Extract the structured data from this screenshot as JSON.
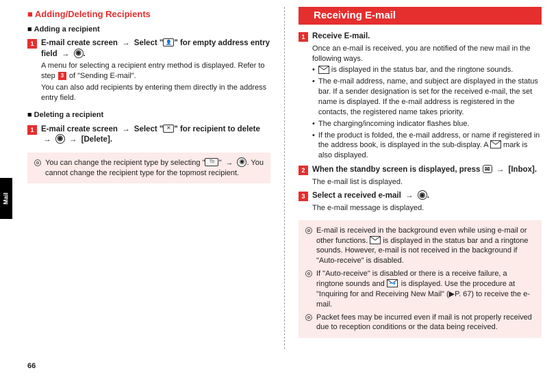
{
  "page_number": "66",
  "side_tab": "Mail",
  "left": {
    "heading": "Adding/Deleting Recipients",
    "add": {
      "sub": "Adding a recipient",
      "step1_a": "E-mail create screen",
      "step1_b": "Select \"",
      "step1_c": "\" for empty address entry field",
      "step1_end": ".",
      "desc1": "A menu for selecting a recipient entry method is displayed. Refer to step",
      "desc1b": "of \"Sending E-mail\".",
      "desc2": "You can also add recipients by entering them directly in the address entry field."
    },
    "del": {
      "sub": "Deleting a recipient",
      "step1_a": "E-mail create screen",
      "step1_b": "Select \"",
      "step1_c": "\" for recipient to delete",
      "step1_d": "[Delete]."
    },
    "note": {
      "a": "You can change the recipient type by selecting \"",
      "b": "\"",
      "c": ". You cannot change the recipient type for the topmost recipient."
    }
  },
  "right": {
    "heading": "Receiving E-mail",
    "s1": {
      "title": "Receive E-mail.",
      "lead": "Once an e-mail is received, you are notified of the new mail in the following ways.",
      "b1a": "",
      "b1b": " is displayed in the status bar, and the ringtone sounds.",
      "b2": "The e-mail address, name, and subject are displayed in the status bar. If a sender designation is set for the received e-mail, the set name is displayed. If the e-mail address is registered in the contacts, the registered name takes priority.",
      "b3": "The charging/incoming indicator flashes blue.",
      "b4a": "If the product is folded, the e-mail address, or name if registered in the address book, is displayed in the sub-display. A ",
      "b4b": " mark is also displayed."
    },
    "s2": {
      "title_a": "When the standby screen is displayed, press ",
      "title_b": "[Inbox].",
      "desc": "The e-mail list is displayed."
    },
    "s3": {
      "title_a": "Select a received e-mail",
      "title_b": ".",
      "desc": "The e-mail message is displayed."
    },
    "note": {
      "n1a": "E-mail is received in the background even while using e-mail or other functions. ",
      "n1b": " is displayed in the status bar and a ringtone sounds. However, e-mail is not received in the background if \"Auto-receive\" is disabled.",
      "n2a": "If \"Auto-receive\" is disabled or there is a receive failure, a ringtone sounds and ",
      "n2b": " is displayed. Use the procedure at \"Inquiring for and Receiving New Mail\" (▶P. 67) to receive the e-mail.",
      "n3": "Packet fees may be incurred even if mail is not properly received due to reception conditions or the data being received."
    }
  }
}
